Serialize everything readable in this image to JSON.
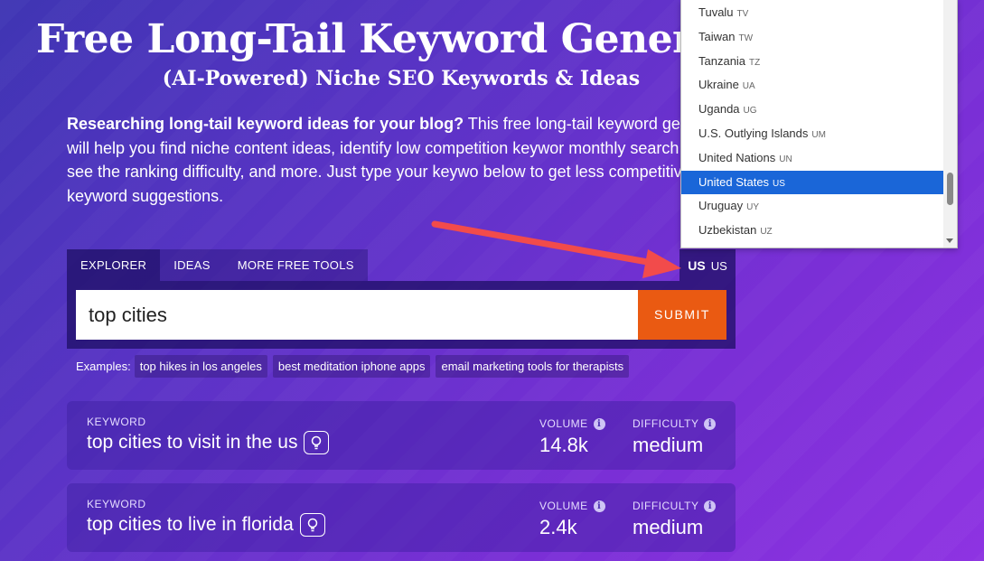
{
  "hero": {
    "title": "Free Long-Tail Keyword Genera",
    "subtitle": "(AI-Powered) Niche SEO Keywords & Ideas"
  },
  "intro": {
    "bold": "Researching long-tail keyword ideas for your blog?",
    "text": " This free long-tail keyword generator will help you find niche content ideas, identify low competition keywor monthly search volume, see the ranking difficulty, and more. Just type your keywo below to get less competitive long-tail keyword suggestions."
  },
  "tabs": [
    "EXPLORER",
    "IDEAS",
    "MORE FREE TOOLS"
  ],
  "country": {
    "code": "US",
    "label": "US"
  },
  "search": {
    "value": "top cities",
    "submit_label": "SUBMIT"
  },
  "examples": {
    "label": "Examples:",
    "items": [
      "top hikes in los angeles",
      "best meditation iphone apps",
      "email marketing tools for therapists"
    ]
  },
  "results": [
    {
      "keyword_label": "KEYWORD",
      "keyword": "top cities to visit in the us",
      "volume_label": "VOLUME",
      "volume": "14.8k",
      "difficulty_label": "DIFFICULTY",
      "difficulty": "medium"
    },
    {
      "keyword_label": "KEYWORD",
      "keyword": "top cities to live in florida",
      "volume_label": "VOLUME",
      "volume": "2.4k",
      "difficulty_label": "DIFFICULTY",
      "difficulty": "medium"
    }
  ],
  "dropdown": {
    "items": [
      {
        "name": "Tuvalu",
        "code": "TV"
      },
      {
        "name": "Taiwan",
        "code": "TW"
      },
      {
        "name": "Tanzania",
        "code": "TZ"
      },
      {
        "name": "Ukraine",
        "code": "UA"
      },
      {
        "name": "Uganda",
        "code": "UG"
      },
      {
        "name": "U.S. Outlying Islands",
        "code": "UM"
      },
      {
        "name": "United Nations",
        "code": "UN"
      },
      {
        "name": "United States",
        "code": "US"
      },
      {
        "name": "Uruguay",
        "code": "UY"
      },
      {
        "name": "Uzbekistan",
        "code": "UZ"
      }
    ],
    "selected_index": 7
  },
  "colors": {
    "accent": "#ea5a12",
    "selected": "#1a66d8",
    "arrow": "#f24b4b"
  },
  "info_glyph": "i"
}
